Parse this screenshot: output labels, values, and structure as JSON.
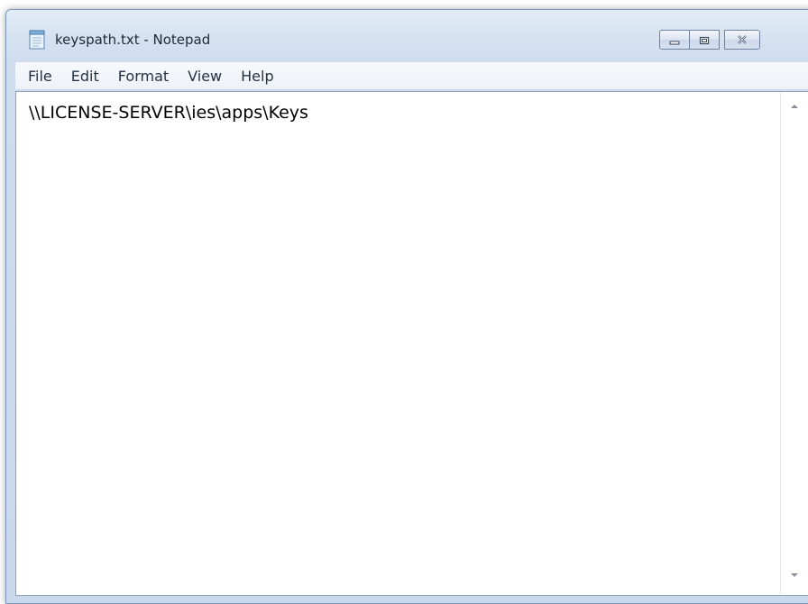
{
  "window": {
    "title": "keyspath.txt - Notepad",
    "icon": "notepad-icon"
  },
  "caption_buttons": {
    "minimize": "minimize-icon",
    "maximize": "maximize-icon",
    "close": "close-icon"
  },
  "menu": {
    "items": [
      {
        "label": "File"
      },
      {
        "label": "Edit"
      },
      {
        "label": "Format"
      },
      {
        "label": "View"
      },
      {
        "label": "Help"
      }
    ]
  },
  "editor": {
    "content": "\\\\LICENSE-SERVER\\ies\\apps\\Keys"
  },
  "colors": {
    "frame": "#cad8ec",
    "menubar": "#f2f5fa",
    "text": "#000000"
  }
}
